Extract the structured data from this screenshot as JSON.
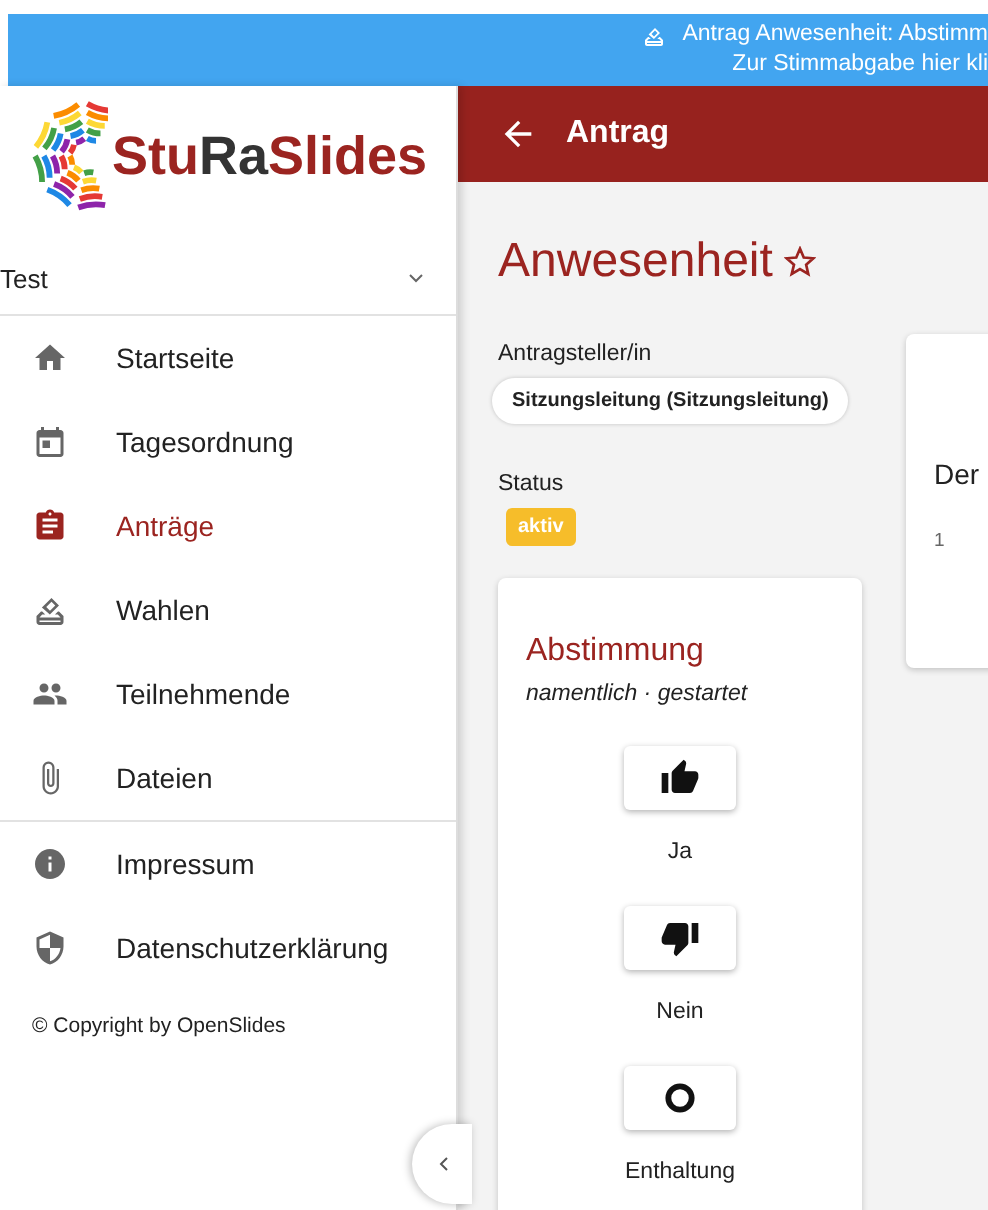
{
  "banner": {
    "lines": [
      "Antrag Anwesenheit: Abstimm",
      "Zur Stimmabgabe hier kli"
    ]
  },
  "sidebar": {
    "logo": {
      "parts": [
        {
          "text": "Stu",
          "kind": "accent"
        },
        {
          "text": "Ra",
          "kind": "dark"
        },
        {
          "text": "Slides",
          "kind": "accent"
        }
      ]
    },
    "meeting_select": {
      "value": "Test"
    },
    "items": [
      {
        "label": "Startseite",
        "selected": false
      },
      {
        "label": "Tagesordnung",
        "selected": false
      },
      {
        "label": "Anträge",
        "selected": true
      },
      {
        "label": "Wahlen",
        "selected": false
      },
      {
        "label": "Teilnehmende",
        "selected": false
      },
      {
        "label": "Dateien",
        "selected": false
      }
    ],
    "footer_items": [
      {
        "label": "Impressum",
        "selected": false
      },
      {
        "label": "Datenschutzerklärung",
        "selected": false
      }
    ],
    "copyright": "© Copyright by OpenSlides"
  },
  "header": {
    "title": "Antrag"
  },
  "motion": {
    "title": "Anwesenheit",
    "favorite": false,
    "submitter_label": "Antragsteller/in",
    "submitter": "Sitzungsleitung (Sitzungsleitung)",
    "status_label": "Status",
    "status": "aktiv",
    "poll": {
      "title": "Abstimmung",
      "subtitle": "namentlich · gestartet",
      "options": [
        {
          "label": "Ja",
          "kind": "yes"
        },
        {
          "label": "Nein",
          "kind": "no"
        },
        {
          "label": "Enthaltung",
          "kind": "abstain"
        }
      ]
    },
    "text_card": {
      "heading": "Der",
      "line_number": "1"
    }
  }
}
